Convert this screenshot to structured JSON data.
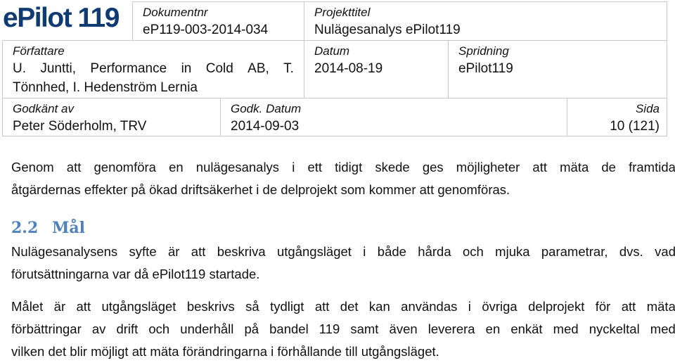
{
  "header": {
    "logo_text": "ePilot 119",
    "brand_color": "#0f3a72",
    "document_number": {
      "label": "Dokumentnr",
      "value": "eP119-003-2014-034"
    },
    "project_title": {
      "label": "Projekttitel",
      "value": "Nulägesanalys ePilot119"
    },
    "author": {
      "label": "Författare",
      "line1_words": [
        "U.",
        "Juntti,",
        "Performance",
        "in",
        "Cold",
        "AB,",
        "T."
      ],
      "line2": "Tönnhed, I. Hedenström Lernia"
    },
    "date": {
      "label": "Datum",
      "value": "2014-08-19"
    },
    "distribution": {
      "label": "Spridning",
      "value": "ePilot119"
    },
    "approved_by": {
      "label": "Godkänt av",
      "value": "Peter Söderholm, TRV"
    },
    "approval_date": {
      "label": "Godk. Datum",
      "value": "2014-09-03"
    },
    "page": {
      "label": "Sida",
      "value": "10 (121)"
    }
  },
  "body": {
    "intro_line1_words": [
      "Genom",
      "att",
      "genomföra",
      "en",
      "nulägesanalys",
      "i",
      "ett",
      "tidigt",
      "skede",
      "ges",
      "möjligheter",
      "att",
      "mäta",
      "de",
      "framtida"
    ],
    "intro_line2": "åtgärdernas effekter på ökad driftsäkerhet i de delprojekt som kommer att genomföras.",
    "section": {
      "number": "2.2",
      "title": "Mål",
      "color": "#4f81bd"
    },
    "purpose_line1_words": [
      "Nulägesanalysens",
      "syfte",
      "är",
      "att",
      "beskriva",
      "utgångsläget",
      "i",
      "både",
      "hårda",
      "och",
      "mjuka",
      "parametrar,",
      "dvs.",
      "vad"
    ],
    "purpose_line2": "förutsättningarna var då ePilot119 startade.",
    "goal_line1_words": [
      "Målet",
      "är",
      "att",
      "utgångsläget",
      "beskrivs",
      "så",
      "tydligt",
      "att",
      "det",
      "kan",
      "användas",
      "i",
      "övriga",
      "delprojekt",
      "för",
      "att",
      "mäta"
    ],
    "goal_line2_words": [
      "förbättringar",
      "av",
      "drift",
      "och",
      "underhåll",
      "på",
      "bandel",
      "119",
      "samt",
      "även",
      "leverera",
      "en",
      "enkät",
      "med",
      "nyckeltal",
      "med"
    ],
    "goal_line3": "vilken det blir möjligt att mäta förändringarna i förhållande till utgångsläget."
  }
}
